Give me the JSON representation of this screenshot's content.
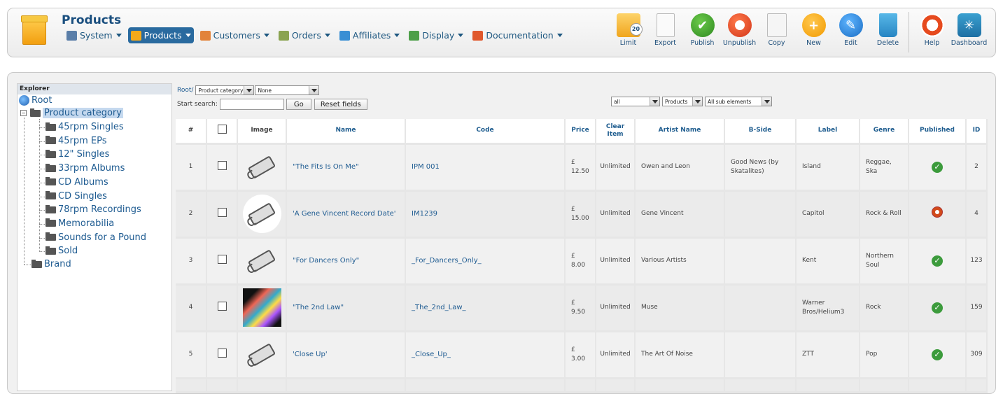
{
  "header": {
    "title": "Products",
    "menu": [
      {
        "label": "System",
        "icon": "tools-icon",
        "color": "#5a7ea8"
      },
      {
        "label": "Products",
        "icon": "box-icon",
        "color": "#f4a91a",
        "active": true
      },
      {
        "label": "Customers",
        "icon": "users-icon",
        "color": "#e2833a"
      },
      {
        "label": "Orders",
        "icon": "orders-icon",
        "color": "#8aa350"
      },
      {
        "label": "Affiliates",
        "icon": "affiliates-icon",
        "color": "#3a8fd4"
      },
      {
        "label": "Display",
        "icon": "display-icon",
        "color": "#4d9f48"
      },
      {
        "label": "Documentation",
        "icon": "lifebuoy-icon",
        "color": "#e0582c"
      }
    ]
  },
  "toolbar": [
    {
      "label": "Limit",
      "icon": "limit-icon"
    },
    {
      "label": "Export",
      "icon": "export-icon"
    },
    {
      "label": "Publish",
      "icon": "publish-icon"
    },
    {
      "label": "Unpublish",
      "icon": "unpublish-icon"
    },
    {
      "label": "Copy",
      "icon": "copy-icon"
    },
    {
      "label": "New",
      "icon": "new-icon"
    },
    {
      "label": "Edit",
      "icon": "edit-icon"
    },
    {
      "label": "Delete",
      "icon": "delete-icon"
    },
    {
      "label": "Help",
      "icon": "help-icon"
    },
    {
      "label": "Dashboard",
      "icon": "dashboard-icon"
    }
  ],
  "limit_badge": "20",
  "explorer": {
    "title": "Explorer",
    "root": "Root",
    "category": "Product category",
    "children": [
      "45rpm Singles",
      "45rpm EPs",
      "12\" Singles",
      "33rpm Albums",
      "CD Albums",
      "CD Singles",
      "78rpm Recordings",
      "Memorabilia",
      "Sounds for a Pound",
      "Sold"
    ],
    "brand": "Brand"
  },
  "filters": {
    "breadcrumb": "Root/",
    "category_select": "Product category",
    "value_select": "None",
    "search_label": "Start search:",
    "search_value": "",
    "go_label": "Go",
    "reset_label": "Reset fields",
    "scope_select": "all",
    "type_select": "Products",
    "depth_select": "All sub elements"
  },
  "table": {
    "columns": [
      "#",
      "",
      "Image",
      "Name",
      "Code",
      "Price",
      "Clear Item",
      "Artist Name",
      "B-Side",
      "Label",
      "Genre",
      "Published",
      "ID"
    ],
    "rows": [
      {
        "num": "1",
        "name": "\"The Fits Is On Me\"",
        "code": "IPM 001",
        "price": "£ 12.50",
        "clear": "Unlimited",
        "artist": "Owen and Leon",
        "bside": "Good News (by Skatalites)",
        "label": "Island",
        "genre": "Reggae, Ska",
        "published": true,
        "id": "2",
        "image": "tag"
      },
      {
        "num": "2",
        "name": "'A Gene Vincent Record Date'",
        "code": "IM1239",
        "price": "£ 15.00",
        "clear": "Unlimited",
        "artist": "Gene Vincent",
        "bside": "",
        "label": "Capitol",
        "genre": "Rock & Roll",
        "published": false,
        "id": "4",
        "image": "tag-round"
      },
      {
        "num": "3",
        "name": "\"For Dancers Only\"",
        "code": "_For_Dancers_Only_",
        "price": "£ 8.00",
        "clear": "Unlimited",
        "artist": "Various Artists",
        "bside": "",
        "label": "Kent",
        "genre": "Northern Soul",
        "published": true,
        "id": "123",
        "image": "tag"
      },
      {
        "num": "4",
        "name": "\"The 2nd Law\"",
        "code": "_The_2nd_Law_",
        "price": "£ 9.50",
        "clear": "Unlimited",
        "artist": "Muse",
        "bside": "",
        "label": "Warner Bros/Helium3",
        "genre": "Rock",
        "published": true,
        "id": "159",
        "image": "album"
      },
      {
        "num": "5",
        "name": "'Close Up'",
        "code": "_Close_Up_",
        "price": "£ 3.00",
        "clear": "Unlimited",
        "artist": "The Art Of Noise",
        "bside": "",
        "label": "ZTT",
        "genre": "Pop",
        "published": true,
        "id": "309",
        "image": "tag"
      }
    ]
  }
}
